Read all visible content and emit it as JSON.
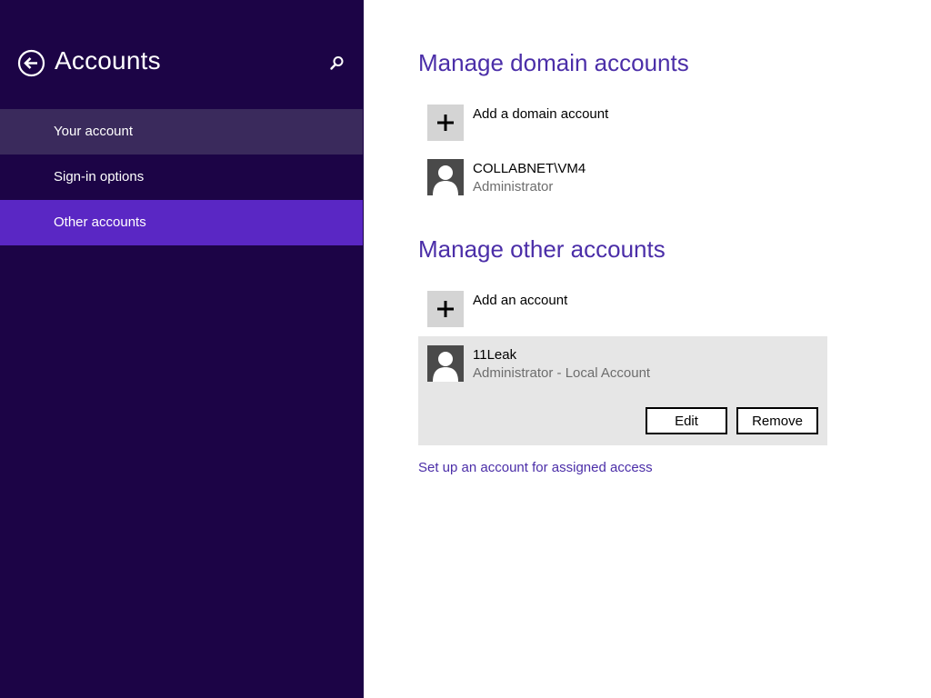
{
  "left_pane": {
    "title": "Accounts",
    "nav_items": [
      {
        "label": "Your account",
        "state": "hover"
      },
      {
        "label": "Sign-in options",
        "state": "normal"
      },
      {
        "label": "Other accounts",
        "state": "selected"
      }
    ],
    "background": "#1c0446",
    "selected_color": "#5a27c4",
    "hover_color": "#3a2a5c",
    "icons": {
      "back": "back-arrow-icon",
      "search": "search-icon"
    }
  },
  "right_pane": {
    "domain_section": {
      "title": "Manage domain accounts",
      "add_label": "Add a domain account",
      "accounts": [
        {
          "name": "COLLABNET\\VM4",
          "role": "Administrator"
        }
      ]
    },
    "other_section": {
      "title": "Manage other accounts",
      "add_label": "Add an account",
      "accounts": [
        {
          "name": "11Leak",
          "role": "Administrator - Local Account",
          "selected": true
        }
      ],
      "edit_label": "Edit",
      "remove_label": "Remove"
    },
    "assigned_access_link": "Set up an account for assigned access",
    "accent_color": "#4b2ea8"
  }
}
